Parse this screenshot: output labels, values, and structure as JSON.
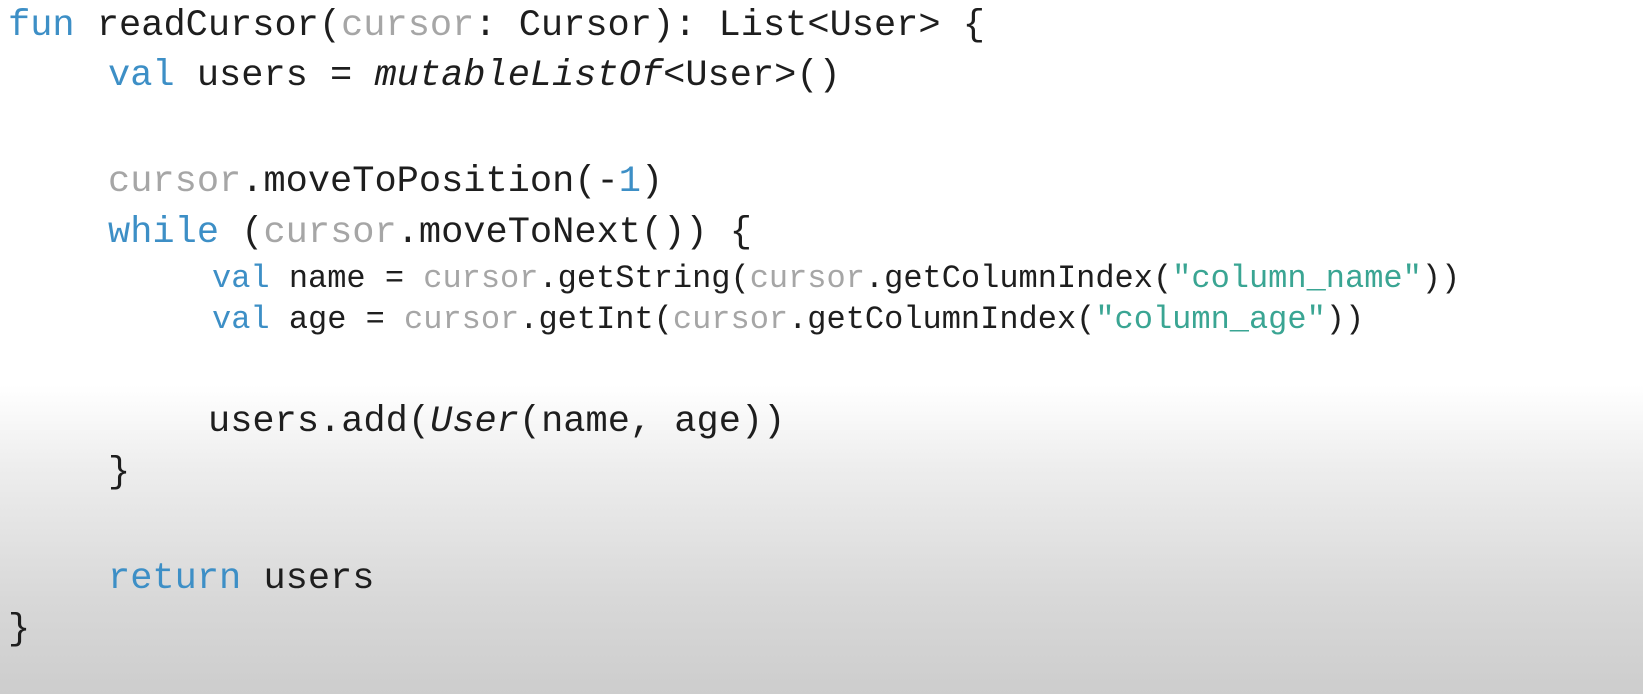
{
  "code": {
    "line1": {
      "kw_fun": "fun",
      "fn_name": " readCursor(",
      "param": "cursor",
      "sig_rest": ": Cursor): List<User> {"
    },
    "line2": {
      "kw_val": "val",
      "decl": " users = ",
      "call": "mutableListOf",
      "rest": "<User>()"
    },
    "line3": {
      "recv": "cursor",
      "call": ".moveToPosition(-",
      "num": "1",
      "close": ")"
    },
    "line4": {
      "kw_while": "while",
      "open": " (",
      "recv": "cursor",
      "rest": ".moveToNext()) {"
    },
    "line5": {
      "kw_val": "val",
      "decl": " name = ",
      "recv": "cursor",
      "call": ".getString(",
      "recv2": "cursor",
      "call2": ".getColumnIndex(",
      "str": "\"column_name\"",
      "close": "))"
    },
    "line6": {
      "kw_val": "val",
      "decl": " age = ",
      "recv": "cursor",
      "call": ".getInt(",
      "recv2": "cursor",
      "call2": ".getColumnIndex(",
      "str": "\"column_age\"",
      "close": "))"
    },
    "line7": {
      "pre": "users.add(",
      "ctor": "User",
      "rest": "(name, age))"
    },
    "line8": {
      "brace": "}"
    },
    "line9": {
      "kw_return": "return",
      "rest": " users"
    },
    "line10": {
      "brace": "}"
    }
  },
  "colors": {
    "keyword": "#3d8fc6",
    "parameter": "#a6a6a6",
    "string": "#3aa593",
    "text": "#1e1e1e"
  }
}
